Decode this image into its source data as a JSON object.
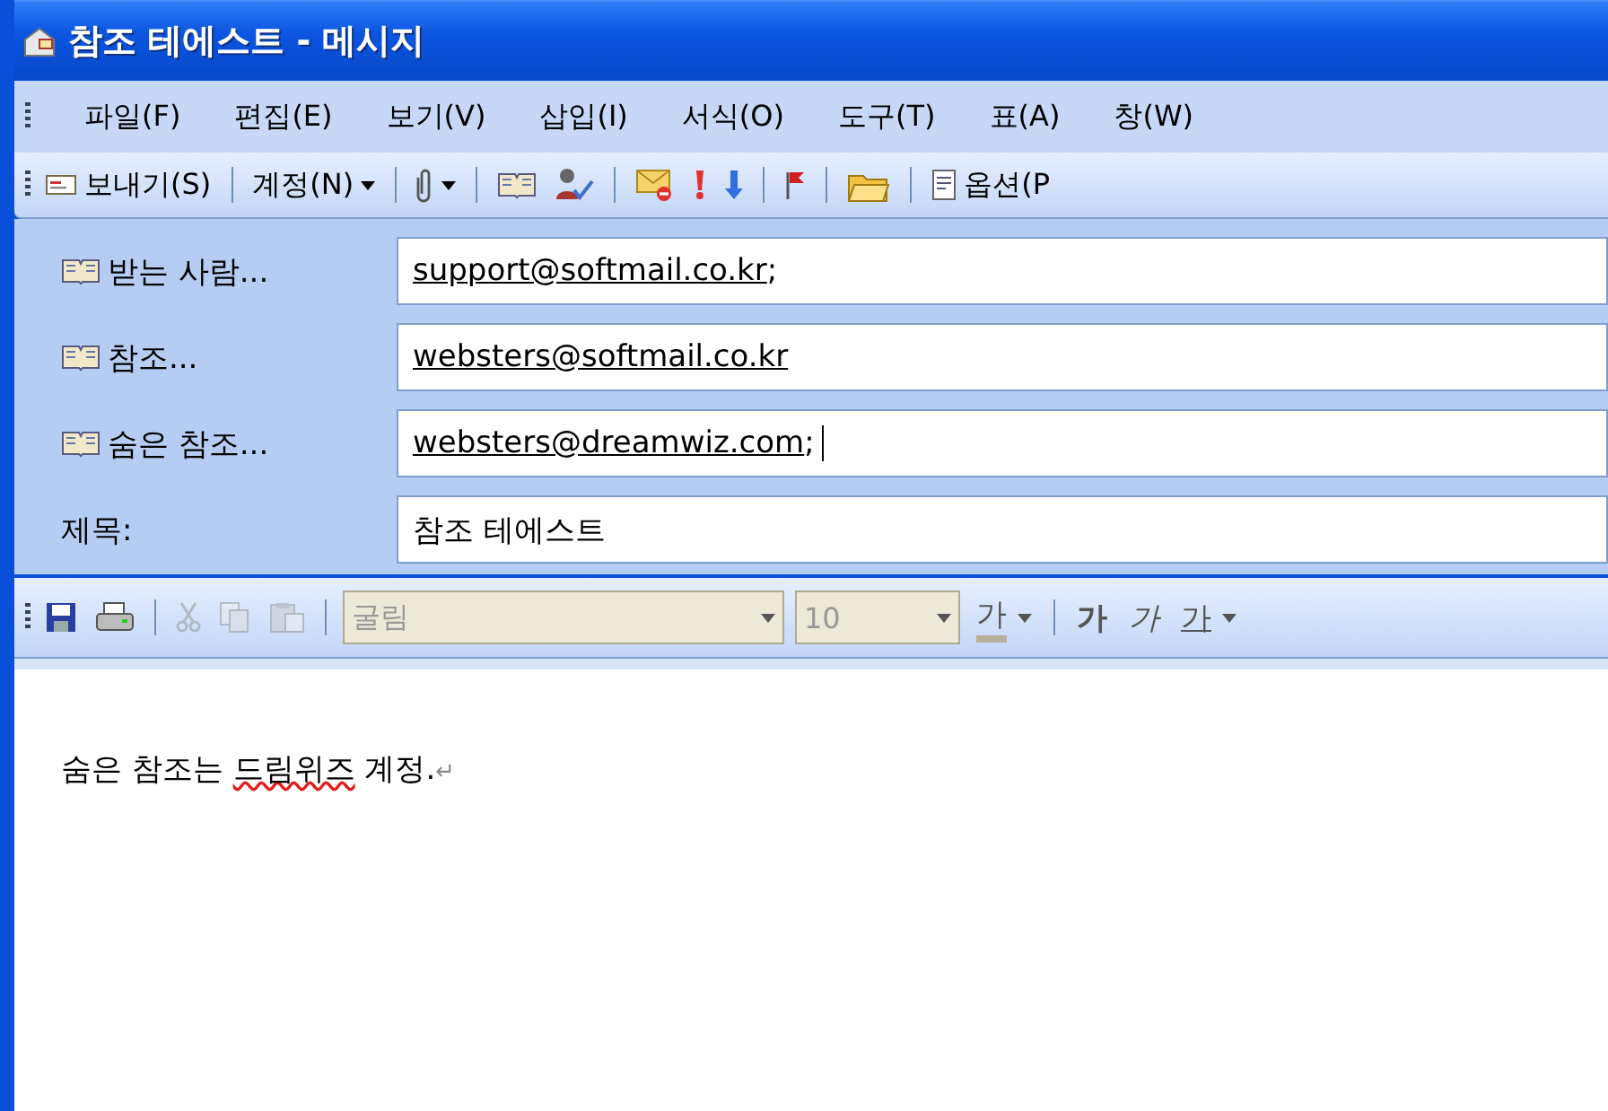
{
  "window": {
    "title": "참조 테에스트 - 메시지"
  },
  "menu": [
    {
      "label": "파일(F)"
    },
    {
      "label": "편집(E)"
    },
    {
      "label": "보기(V)"
    },
    {
      "label": "삽입(I)"
    },
    {
      "label": "서식(O)"
    },
    {
      "label": "도구(T)"
    },
    {
      "label": "표(A)"
    },
    {
      "label": "창(W)"
    }
  ],
  "toolbar": [
    {
      "kind": "button",
      "label": "보내기(S)"
    },
    {
      "kind": "separator"
    },
    {
      "kind": "dropdown",
      "label": "계정(N)"
    },
    {
      "kind": "separator"
    },
    {
      "kind": "dropdown"
    },
    {
      "kind": "separator"
    },
    {
      "kind": "button"
    },
    {
      "kind": "button"
    },
    {
      "kind": "separator"
    },
    {
      "kind": "button"
    },
    {
      "kind": "button"
    },
    {
      "kind": "button"
    },
    {
      "kind": "separator"
    },
    {
      "kind": "button"
    },
    {
      "kind": "separator"
    },
    {
      "kind": "button"
    },
    {
      "kind": "separator"
    },
    {
      "kind": "button",
      "label": "옵션(P"
    }
  ],
  "fields": [
    {
      "label": "받는 사람...",
      "kind": "address",
      "recipients": [
        "support@softmail.co.kr"
      ],
      "trailing": ";",
      "focused": false
    },
    {
      "label": "참조...",
      "kind": "address",
      "recipients": [
        "websters@softmail.co.kr"
      ],
      "focused": false
    },
    {
      "label": "숨은 참조...",
      "kind": "address",
      "recipients": [
        "websters@dreamwiz.com"
      ],
      "trailing": ";",
      "focused": true
    },
    {
      "label": "제목:",
      "kind": "subject",
      "value": "참조 테에스트",
      "focused": false
    }
  ],
  "format_toolbar": [
    {
      "kind": "button",
      "disabled": false
    },
    {
      "kind": "button",
      "disabled": false
    },
    {
      "kind": "separator"
    },
    {
      "kind": "button",
      "disabled": true
    },
    {
      "kind": "button",
      "disabled": true
    },
    {
      "kind": "button",
      "disabled": true
    },
    {
      "kind": "separator"
    },
    {
      "kind": "combo",
      "value": "굴림",
      "disabled": true
    },
    {
      "kind": "combo",
      "value": "10",
      "disabled": true
    },
    {
      "kind": "glyph",
      "label": "가",
      "dropdown": true
    },
    {
      "kind": "separator"
    },
    {
      "kind": "glyph",
      "label": "가",
      "dropdown": false
    },
    {
      "kind": "glyph",
      "label": "가",
      "dropdown": false
    },
    {
      "kind": "glyph",
      "label": "가",
      "dropdown": true
    }
  ],
  "body": {
    "segments": [
      {
        "text": "숨은 참조는 ",
        "misspelled": false
      },
      {
        "text": "드림위즈",
        "misspelled": true
      },
      {
        "text": " 계정.",
        "misspelled": false
      }
    ],
    "paragraph_mark": "↵"
  }
}
